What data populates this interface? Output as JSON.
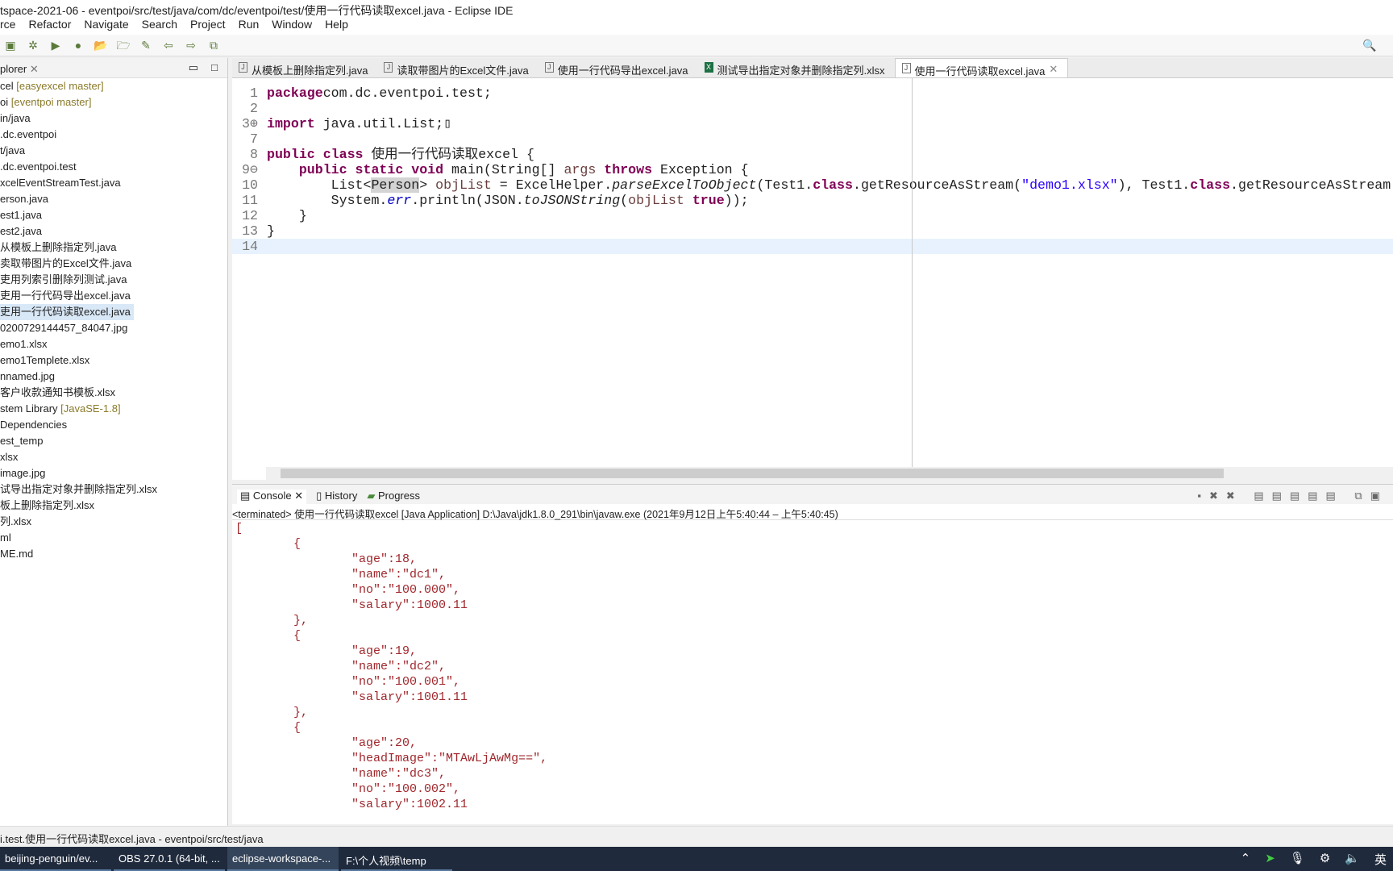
{
  "window": {
    "title": "tspace-2021-06 - eventpoi/src/test/java/com/dc/eventpoi/test/使用一行代码读取excel.java - Eclipse IDE"
  },
  "menu": [
    "rce",
    "Refactor",
    "Navigate",
    "Search",
    "Project",
    "Run",
    "Window",
    "Help"
  ],
  "explorer": {
    "title": "plorer",
    "items": [
      {
        "name": "cel",
        "deco": " [easyexcel master]"
      },
      {
        "name": "oi",
        "deco": " [eventpoi master]"
      },
      {
        "name": "in/java"
      },
      {
        "name": ".dc.eventpoi"
      },
      {
        "name": "t/java"
      },
      {
        "name": ".dc.eventpoi.test"
      },
      {
        "name": "xcelEventStreamTest.java"
      },
      {
        "name": "erson.java"
      },
      {
        "name": "est1.java"
      },
      {
        "name": "est2.java"
      },
      {
        "name": "从模板上删除指定列.java"
      },
      {
        "name": "卖取带图片的Excel文件.java"
      },
      {
        "name": "吏用列索引删除列测试.java"
      },
      {
        "name": "吏用一行代码导出excel.java"
      },
      {
        "name": "吏用一行代码读取excel.java",
        "selected": true
      },
      {
        "name": "0200729144457_84047.jpg"
      },
      {
        "name": "emo1.xlsx"
      },
      {
        "name": "emo1Templete.xlsx"
      },
      {
        "name": "nnamed.jpg"
      },
      {
        "name": "客户收款通知书模板.xlsx"
      },
      {
        "name": "stem Library",
        "deco": " [JavaSE-1.8]"
      },
      {
        "name": " Dependencies"
      },
      {
        "name": ""
      },
      {
        "name": "est_temp"
      },
      {
        "name": "xlsx"
      },
      {
        "name": "image.jpg"
      },
      {
        "name": "试导出指定对象并删除指定列.xlsx"
      },
      {
        "name": "板上删除指定列.xlsx"
      },
      {
        "name": "列.xlsx"
      },
      {
        "name": ""
      },
      {
        "name": ""
      },
      {
        "name": "ml"
      },
      {
        "name": "ME.md"
      }
    ]
  },
  "tabs": [
    {
      "label": "从模板上删除指定列.java",
      "icon": "java"
    },
    {
      "label": "读取带图片的Excel文件.java",
      "icon": "java"
    },
    {
      "label": "使用一行代码导出excel.java",
      "icon": "java"
    },
    {
      "label": "测试导出指定对象并删除指定列.xlsx",
      "icon": "excel"
    },
    {
      "label": "使用一行代码读取excel.java",
      "icon": "java",
      "active": true
    }
  ],
  "code": [
    {
      "n": "1",
      "t": [
        [
          "kw",
          "package"
        ],
        [
          "",
          "com.dc.eventpoi.test;"
        ]
      ]
    },
    {
      "n": "2",
      "t": []
    },
    {
      "n": "3⊕",
      "t": [
        [
          "kw",
          "import"
        ],
        [
          "",
          " java.util.List;▯"
        ]
      ]
    },
    {
      "n": "7",
      "t": []
    },
    {
      "n": "8",
      "t": [
        [
          "kw",
          "public class"
        ],
        [
          "",
          " 使用一行代码读取excel {"
        ]
      ]
    },
    {
      "n": "9⊖",
      "t": [
        [
          "",
          "    "
        ],
        [
          "kw",
          "public static void"
        ],
        [
          "",
          " main(String[] "
        ],
        [
          "var",
          "args"
        ],
        [
          "",
          " "
        ],
        [
          "kw",
          "throws"
        ],
        [
          "",
          " Exception {"
        ]
      ]
    },
    {
      "n": "10",
      "t": [
        [
          "",
          "        List<"
        ],
        [
          "hl",
          "Person"
        ],
        [
          "",
          "> "
        ],
        [
          "var",
          "objList"
        ],
        [
          "",
          " = ExcelHelper."
        ],
        [
          "it",
          "parseExcelToObject"
        ],
        [
          "",
          "(Test1."
        ],
        [
          "kw",
          "class"
        ],
        [
          "",
          ".getResourceAsStream("
        ],
        [
          "str",
          "\"demo1.xlsx\""
        ],
        [
          "",
          "), Test1."
        ],
        [
          "kw",
          "class"
        ],
        [
          "",
          ".getResourceAsStream"
        ]
      ]
    },
    {
      "n": "11",
      "t": [
        [
          "",
          "        System."
        ],
        [
          "fld",
          "err"
        ],
        [
          "",
          ".println(JSON."
        ],
        [
          "it",
          "toJSONString"
        ],
        [
          "",
          "("
        ],
        [
          "var",
          "objList"
        ],
        [
          ",",
          " "
        ],
        [
          "kw",
          "true"
        ],
        [
          "",
          "));"
        ]
      ]
    },
    {
      "n": "12",
      "t": [
        [
          "",
          "    }"
        ]
      ]
    },
    {
      "n": "13",
      "t": [
        [
          "",
          "}"
        ]
      ]
    },
    {
      "n": "14",
      "t": []
    }
  ],
  "console": {
    "tabs": [
      "Console",
      "History",
      "Progress"
    ],
    "header": "<terminated> 使用一行代码读取excel [Java Application] D:\\Java\\jdk1.8.0_291\\bin\\javaw.exe  (2021年9月12日上午5:40:44 – 上午5:40:45)",
    "lines": [
      "[",
      "\t{",
      "\t\t\"age\":18,",
      "\t\t\"name\":\"dc1\",",
      "\t\t\"no\":\"100.000\",",
      "\t\t\"salary\":1000.11",
      "\t},",
      "\t{",
      "\t\t\"age\":19,",
      "\t\t\"name\":\"dc2\",",
      "\t\t\"no\":\"100.001\",",
      "\t\t\"salary\":1001.11",
      "\t},",
      "\t{",
      "\t\t\"age\":20,",
      "\t\t\"headImage\":\"MTAwLjAwMg==\",",
      "\t\t\"name\":\"dc3\",",
      "\t\t\"no\":\"100.002\",",
      "\t\t\"salary\":1002.11"
    ]
  },
  "status": "i.test.使用一行代码读取excel.java - eventpoi/src/test/java",
  "taskbar": [
    {
      "label": "beijing-penguin/ev..."
    },
    {
      "label": "OBS 27.0.1 (64-bit, ..."
    },
    {
      "label": "eclipse-workspace-...",
      "active": true
    },
    {
      "label": "F:\\个人视频\\temp"
    }
  ],
  "tray": {
    "ime": "英"
  }
}
